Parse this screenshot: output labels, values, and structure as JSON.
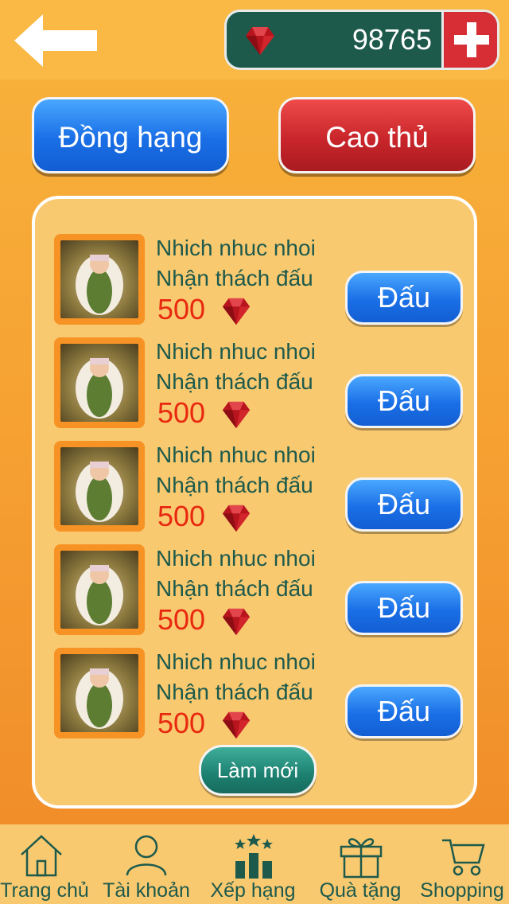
{
  "header": {
    "back_icon": "arrow-left-icon",
    "gem_icon": "ruby-icon",
    "gem_count": "98765",
    "plus_icon": "plus-icon"
  },
  "modes": {
    "rank_label": "Đồng hạng",
    "master_label": "Cao thủ"
  },
  "opponents": [
    {
      "name": "Nhich nhuc nhoi",
      "subtitle": "Nhận thách đấu",
      "points": "500",
      "fight_label": "Đấu"
    },
    {
      "name": "Nhich nhuc nhoi",
      "subtitle": "Nhận thách đấu",
      "points": "500",
      "fight_label": "Đấu"
    },
    {
      "name": "Nhich nhuc nhoi",
      "subtitle": "Nhận thách đấu",
      "points": "500",
      "fight_label": "Đấu"
    },
    {
      "name": "Nhich nhuc nhoi",
      "subtitle": "Nhận thách đấu",
      "points": "500",
      "fight_label": "Đấu"
    },
    {
      "name": "Nhich nhuc nhoi",
      "subtitle": "Nhận thách đấu",
      "points": "500",
      "fight_label": "Đấu"
    }
  ],
  "refresh_label": "Làm mới",
  "nav": [
    {
      "label": "Trang chủ",
      "icon": "home-icon"
    },
    {
      "label": "Tài khoản",
      "icon": "user-icon"
    },
    {
      "label": "Xếp hạng",
      "icon": "ranking-icon"
    },
    {
      "label": "Quà tặng",
      "icon": "gift-icon"
    },
    {
      "label": "Shopping",
      "icon": "cart-icon"
    }
  ],
  "colors": {
    "accent_green": "#1d5a4c",
    "button_blue": "#1a6fe6",
    "button_red": "#c9262b",
    "points_red": "#e8290f",
    "panel": "#f9c970"
  }
}
